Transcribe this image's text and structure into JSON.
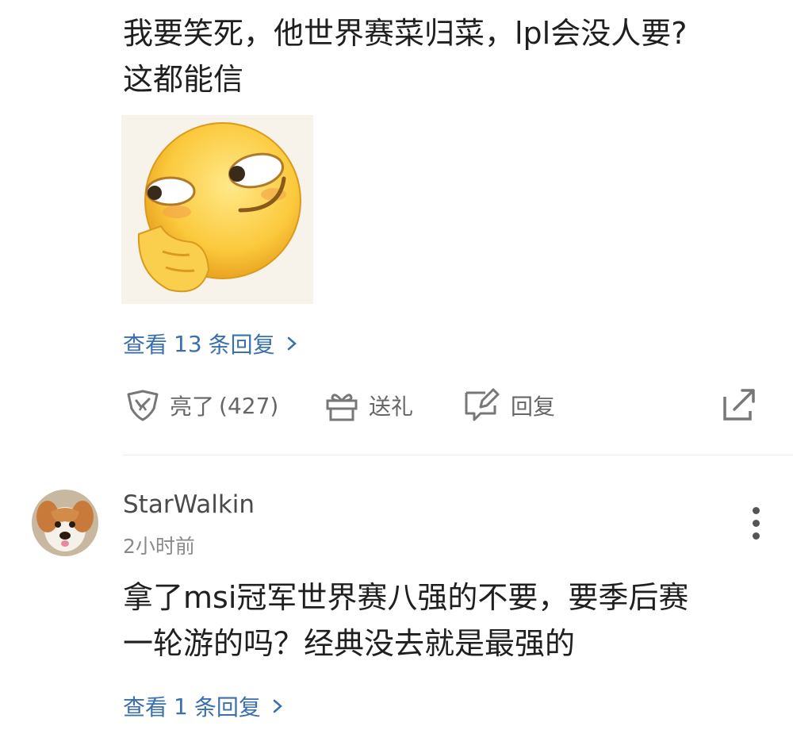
{
  "comment1": {
    "text_line1": "我要笑死，他世界赛菜归菜，lpl会没人要?",
    "text_line2": "这都能信",
    "replies": {
      "prefix": "查看",
      "count": "13",
      "suffix": "条回复"
    },
    "actions": {
      "like_label": "亮了",
      "like_count": "(427)",
      "gift_label": "送礼",
      "reply_label": "回复"
    }
  },
  "comment2": {
    "username": "StarWalkin",
    "time": "2小时前",
    "text_line1": "拿了msi冠军世界赛八强的不要，要季后赛",
    "text_line2": "一轮游的吗？经典没去就是最强的",
    "replies": {
      "prefix": "查看",
      "count": "1",
      "suffix": "条回复"
    }
  },
  "icons": {
    "like": "fire-shield-icon",
    "gift": "gift-icon",
    "reply": "edit-reply-icon",
    "share": "share-icon",
    "more": "more-vertical-icon",
    "emoji": "smirk-emoji-sticker"
  },
  "colors": {
    "link": "#3a6fb0",
    "text": "#1f1f1f",
    "secondary": "#666666",
    "divider": "#ececec"
  }
}
